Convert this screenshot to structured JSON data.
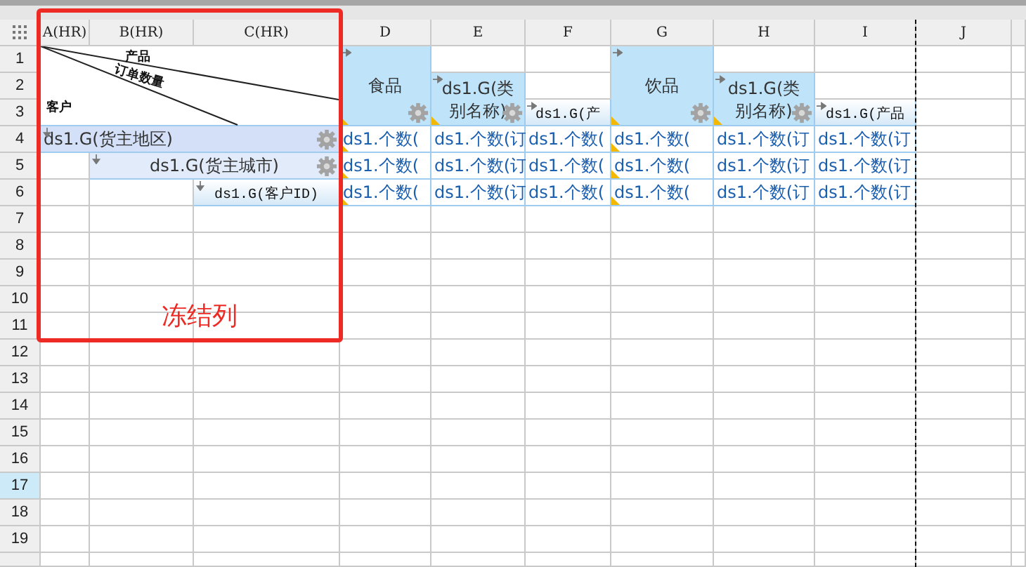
{
  "columns": [
    {
      "label": "A(HR)",
      "page_break": false
    },
    {
      "label": "B(HR)",
      "page_break": false
    },
    {
      "label": "C(HR)",
      "page_break": false
    },
    {
      "label": "D",
      "page_break": false
    },
    {
      "label": "E",
      "page_break": false
    },
    {
      "label": "F",
      "page_break": false
    },
    {
      "label": "G",
      "page_break": false
    },
    {
      "label": "H",
      "page_break": false
    },
    {
      "label": "I",
      "page_break": true
    },
    {
      "label": "J",
      "page_break": false
    }
  ],
  "rows": [
    {
      "label": "1",
      "selected": false
    },
    {
      "label": "2",
      "selected": false
    },
    {
      "label": "3",
      "selected": false
    },
    {
      "label": "4",
      "selected": false
    },
    {
      "label": "5",
      "selected": false
    },
    {
      "label": "6",
      "selected": false
    },
    {
      "label": "7",
      "selected": false
    },
    {
      "label": "8",
      "selected": false
    },
    {
      "label": "9",
      "selected": false
    },
    {
      "label": "10",
      "selected": false
    },
    {
      "label": "11",
      "selected": false
    },
    {
      "label": "12",
      "selected": false
    },
    {
      "label": "13",
      "selected": false
    },
    {
      "label": "14",
      "selected": false
    },
    {
      "label": "15",
      "selected": false
    },
    {
      "label": "16",
      "selected": false
    },
    {
      "label": "17",
      "selected": true
    },
    {
      "label": "18",
      "selected": false
    },
    {
      "label": "19",
      "selected": false
    }
  ],
  "cells": [
    {
      "kind": "slash",
      "labels": [
        "产品",
        "订单数量",
        "客户"
      ]
    },
    {
      "kind": "header",
      "text": "食品",
      "arrow": true,
      "gear": true,
      "marker": true
    },
    {
      "kind": "header",
      "text": "ds1.G(类别名称)",
      "arrow": true,
      "gear": true,
      "marker": true
    },
    {
      "kind": "column-detail",
      "text": "ds1.G(产",
      "arrow": true,
      "gear": false,
      "marker": false
    },
    {
      "kind": "header",
      "text": "饮品",
      "arrow": true,
      "gear": true,
      "marker": true
    },
    {
      "kind": "header",
      "text": "ds1.G(类别名称)",
      "arrow": true,
      "gear": true,
      "marker": true
    },
    {
      "kind": "column-detail",
      "text": "ds1.G(产品",
      "arrow": true,
      "gear": false,
      "marker": false
    },
    {
      "kind": "row-group",
      "text": "ds1.G(货主地区)",
      "arrow": true,
      "gear": true,
      "marker": false
    },
    {
      "kind": "subgroup",
      "text": "ds1.G(货主城市)",
      "arrow": true,
      "gear": true,
      "marker": false
    },
    {
      "kind": "row-detail",
      "text": "ds1.G(客户ID)",
      "arrow": true,
      "gear": false,
      "marker": false
    },
    {
      "kind": "data",
      "text": "ds1.个数(",
      "marker": true
    },
    {
      "kind": "data",
      "text": "ds1.个数(订",
      "marker": false
    },
    {
      "kind": "data",
      "text": "ds1.个数(",
      "marker": false
    },
    {
      "kind": "data",
      "text": "ds1.个数(",
      "marker": true
    },
    {
      "kind": "data",
      "text": "ds1.个数(订",
      "marker": false
    },
    {
      "kind": "data",
      "text": "ds1.个数(订",
      "marker": false
    },
    {
      "kind": "data",
      "text": "ds1.个数(",
      "marker": true
    },
    {
      "kind": "data",
      "text": "ds1.个数(订",
      "marker": false
    },
    {
      "kind": "data",
      "text": "ds1.个数(",
      "marker": false
    },
    {
      "kind": "data",
      "text": "ds1.个数(",
      "marker": true
    },
    {
      "kind": "data",
      "text": "ds1.个数(订",
      "marker": false
    },
    {
      "kind": "data",
      "text": "ds1.个数(订",
      "marker": false
    },
    {
      "kind": "data",
      "text": "ds1.个数(",
      "marker": true
    },
    {
      "kind": "data",
      "text": "ds1.个数(订",
      "marker": false
    },
    {
      "kind": "data",
      "text": "ds1.个数(",
      "marker": false
    },
    {
      "kind": "data",
      "text": "ds1.个数(",
      "marker": true
    },
    {
      "kind": "data",
      "text": "ds1.个数(订",
      "marker": false
    },
    {
      "kind": "data",
      "text": "ds1.个数(订",
      "marker": false
    }
  ],
  "frame": {
    "label": "冻结列"
  }
}
